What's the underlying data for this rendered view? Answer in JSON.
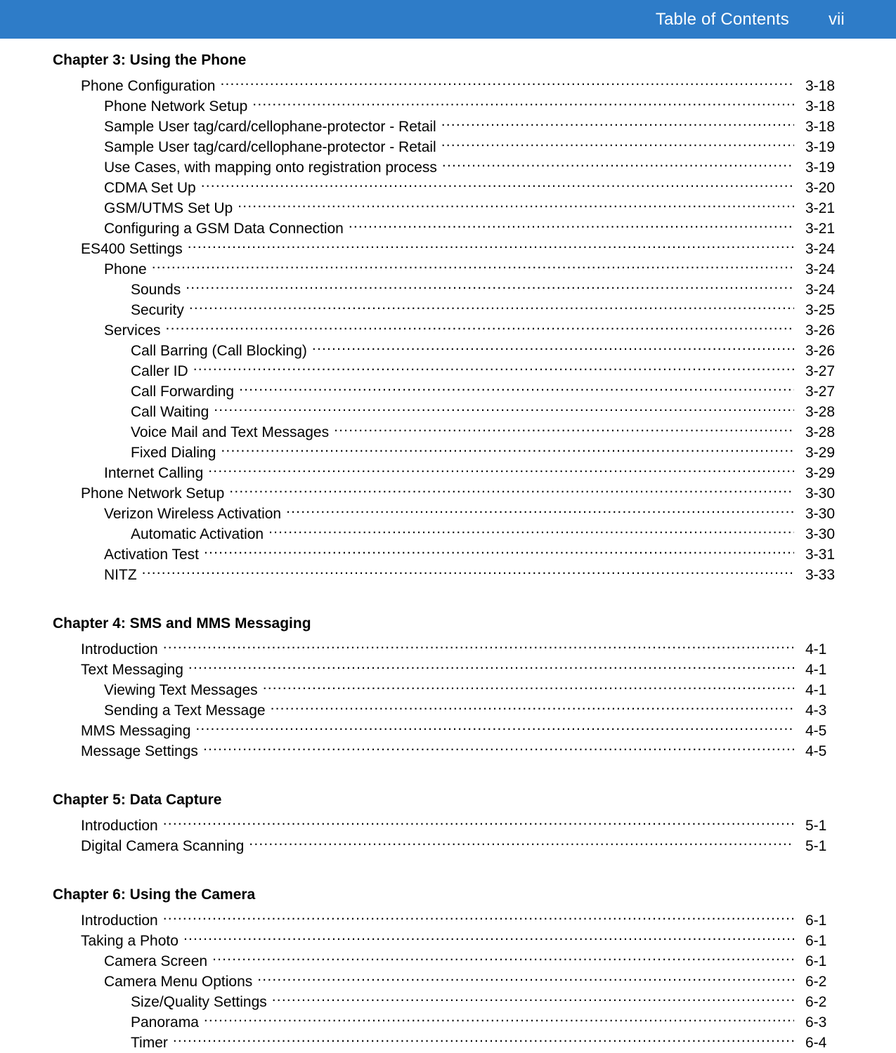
{
  "header": {
    "title": "Table of Contents",
    "page_number": "vii",
    "background_color": "#2E7CC8",
    "text_color": "#ffffff"
  },
  "chapters": [
    {
      "heading": "Chapter 3: Using the Phone",
      "entries": [
        {
          "label": "Phone Configuration",
          "page": "3-18",
          "level": 1
        },
        {
          "label": "Phone Network Setup",
          "page": "3-18",
          "level": 2
        },
        {
          "label": "Sample User tag/card/cellophane-protector - Retail",
          "page": "3-18",
          "level": 2
        },
        {
          "label": "Sample User tag/card/cellophane-protector - Retail",
          "page": "3-19",
          "level": 2
        },
        {
          "label": "Use Cases, with mapping onto registration process",
          "page": "3-19",
          "level": 2
        },
        {
          "label": "CDMA Set Up",
          "page": "3-20",
          "level": 2
        },
        {
          "label": "GSM/UTMS Set Up",
          "page": "3-21",
          "level": 2
        },
        {
          "label": "Configuring a GSM Data Connection",
          "page": "3-21",
          "level": 2
        },
        {
          "label": "ES400 Settings",
          "page": "3-24",
          "level": 1
        },
        {
          "label": "Phone",
          "page": "3-24",
          "level": 2
        },
        {
          "label": "Sounds",
          "page": "3-24",
          "level": 3
        },
        {
          "label": "Security",
          "page": "3-25",
          "level": 3
        },
        {
          "label": "Services",
          "page": "3-26",
          "level": 2
        },
        {
          "label": "Call Barring (Call Blocking)",
          "page": "3-26",
          "level": 3
        },
        {
          "label": "Caller ID",
          "page": "3-27",
          "level": 3
        },
        {
          "label": "Call Forwarding",
          "page": "3-27",
          "level": 3
        },
        {
          "label": "Call Waiting",
          "page": "3-28",
          "level": 3
        },
        {
          "label": "Voice Mail and Text Messages",
          "page": "3-28",
          "level": 3
        },
        {
          "label": "Fixed Dialing",
          "page": "3-29",
          "level": 3
        },
        {
          "label": "Internet Calling",
          "page": "3-29",
          "level": 2
        },
        {
          "label": "Phone Network Setup",
          "page": "3-30",
          "level": 1
        },
        {
          "label": "Verizon Wireless Activation",
          "page": "3-30",
          "level": 2
        },
        {
          "label": "Automatic Activation",
          "page": "3-30",
          "level": 3
        },
        {
          "label": "Activation Test",
          "page": "3-31",
          "level": 2
        },
        {
          "label": "NITZ",
          "page": "3-33",
          "level": 2
        }
      ]
    },
    {
      "heading": "Chapter 4: SMS and MMS Messaging",
      "entries": [
        {
          "label": "Introduction",
          "page": "4-1",
          "level": 1
        },
        {
          "label": "Text Messaging",
          "page": "4-1",
          "level": 1
        },
        {
          "label": "Viewing Text Messages",
          "page": "4-1",
          "level": 2
        },
        {
          "label": "Sending a Text Message",
          "page": "4-3",
          "level": 2
        },
        {
          "label": "MMS Messaging",
          "page": "4-5",
          "level": 1
        },
        {
          "label": "Message Settings",
          "page": "4-5",
          "level": 1
        }
      ]
    },
    {
      "heading": "Chapter 5: Data Capture",
      "entries": [
        {
          "label": "Introduction",
          "page": "5-1",
          "level": 1
        },
        {
          "label": "Digital Camera Scanning",
          "page": "5-1",
          "level": 1
        }
      ]
    },
    {
      "heading": "Chapter 6: Using the Camera",
      "entries": [
        {
          "label": "Introduction",
          "page": "6-1",
          "level": 1
        },
        {
          "label": "Taking a Photo",
          "page": "6-1",
          "level": 1
        },
        {
          "label": "Camera Screen",
          "page": "6-1",
          "level": 2
        },
        {
          "label": "Camera Menu Options",
          "page": "6-2",
          "level": 2
        },
        {
          "label": "Size/Quality Settings",
          "page": "6-2",
          "level": 3
        },
        {
          "label": "Panorama",
          "page": "6-3",
          "level": 3
        },
        {
          "label": "Timer",
          "page": "6-4",
          "level": 3
        }
      ]
    }
  ]
}
